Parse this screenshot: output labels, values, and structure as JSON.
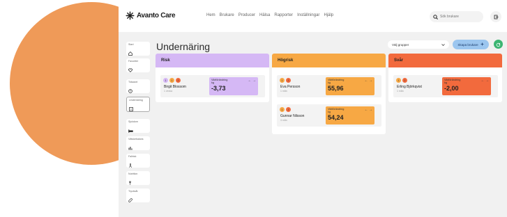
{
  "app": {
    "name": "Avanto Care"
  },
  "nav": [
    "Hem",
    "Brukare",
    "Producer",
    "Hälsa",
    "Rapporter",
    "Inställningar",
    "Hjälp"
  ],
  "search": {
    "placeholder": "Sök brukare"
  },
  "sidebar": [
    {
      "label": "Start"
    },
    {
      "label": "Favoriter"
    },
    {
      "label": "Tidsaxel"
    },
    {
      "label": "Undernäring"
    },
    {
      "label": "Sjukdom"
    },
    {
      "label": "Vätskebalans"
    },
    {
      "label": "Fallrisk"
    },
    {
      "label": "Nutrition"
    },
    {
      "label": "Trycksår"
    }
  ],
  "page": {
    "title": "Undernäring"
  },
  "toolbar": {
    "group_select": "Välj grupper",
    "add_label": "Skapa brukare"
  },
  "colors": {
    "risk": "#d5b8f5",
    "hoglig": "#f7a844",
    "svar": "#f26a3d",
    "blob": "#ef9a58"
  },
  "columns": [
    {
      "title": "Risk",
      "cards": [
        {
          "name": "Birgit Blossom",
          "desc": "1 vecka",
          "metric": "Viktförändring",
          "unit": "kg",
          "value": "-3,73"
        }
      ]
    },
    {
      "title": "Högrisk",
      "cards": [
        {
          "name": "Eva Persson",
          "desc": "1 mån",
          "metric": "Viktförändring",
          "unit": "kg",
          "value": "55,96"
        },
        {
          "name": "Gunnar Nilsson",
          "desc": "3 mån",
          "metric": "Viktförändring",
          "unit": "kg",
          "value": "54,24"
        }
      ]
    },
    {
      "title": "Svår",
      "cards": [
        {
          "name": "Erling Björkqvist",
          "desc": "1 mån",
          "metric": "Viktförändring",
          "unit": "kg",
          "value": "-2,00"
        }
      ]
    }
  ]
}
